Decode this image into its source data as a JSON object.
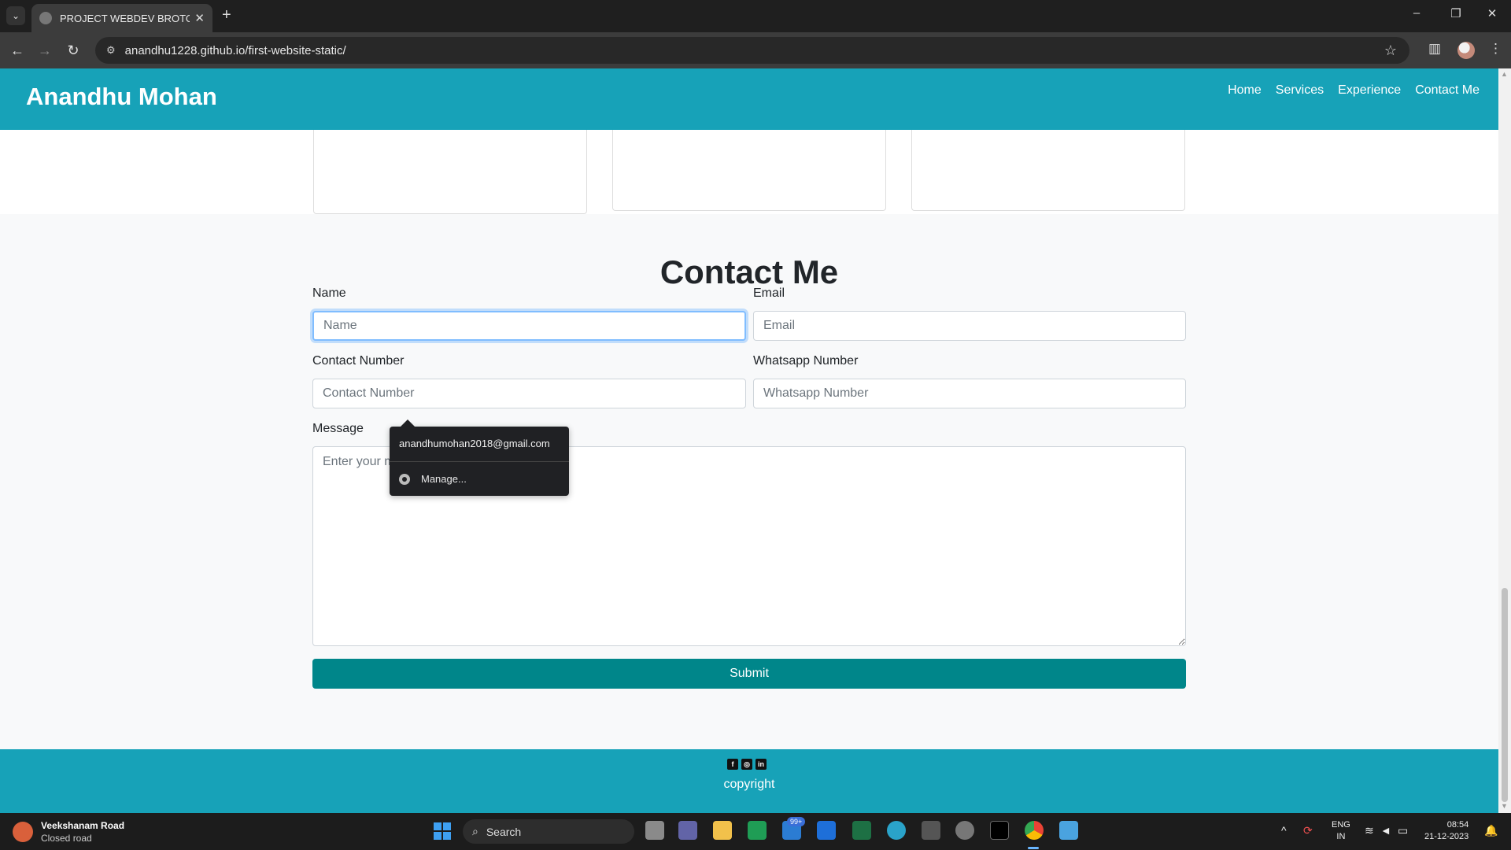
{
  "browser": {
    "tab_title": "PROJECT WEBDEV BROTOTYPE",
    "url": "anandhu1228.github.io/first-website-static/"
  },
  "site": {
    "brand": "Anandhu Mohan",
    "nav": [
      "Home",
      "Services",
      "Experience",
      "Contact Me"
    ]
  },
  "contact": {
    "title": "Contact Me",
    "name_label": "Name",
    "name_placeholder": "Name",
    "email_label": "Email",
    "email_placeholder": "Email",
    "contact_label": "Contact Number",
    "contact_placeholder": "Contact Number",
    "whatsapp_label": "Whatsapp Number",
    "whatsapp_placeholder": "Whatsapp Number",
    "message_label": "Message",
    "message_placeholder": "Enter your message",
    "submit_label": "Submit"
  },
  "autofill": {
    "suggestion": "anandhumohan2018@gmail.com",
    "manage_label": "Manage..."
  },
  "footer": {
    "copyright": "copyright"
  },
  "taskbar": {
    "weather_title": "Veekshanam Road",
    "weather_subtitle": "Closed road",
    "search_label": "Search",
    "mail_badge": "99+",
    "lang_line1": "ENG",
    "lang_line2": "IN",
    "time": "08:54",
    "date": "21-12-2023"
  },
  "colors": {
    "header_bg": "#17a2b8",
    "submit_bg": "#00868a"
  }
}
